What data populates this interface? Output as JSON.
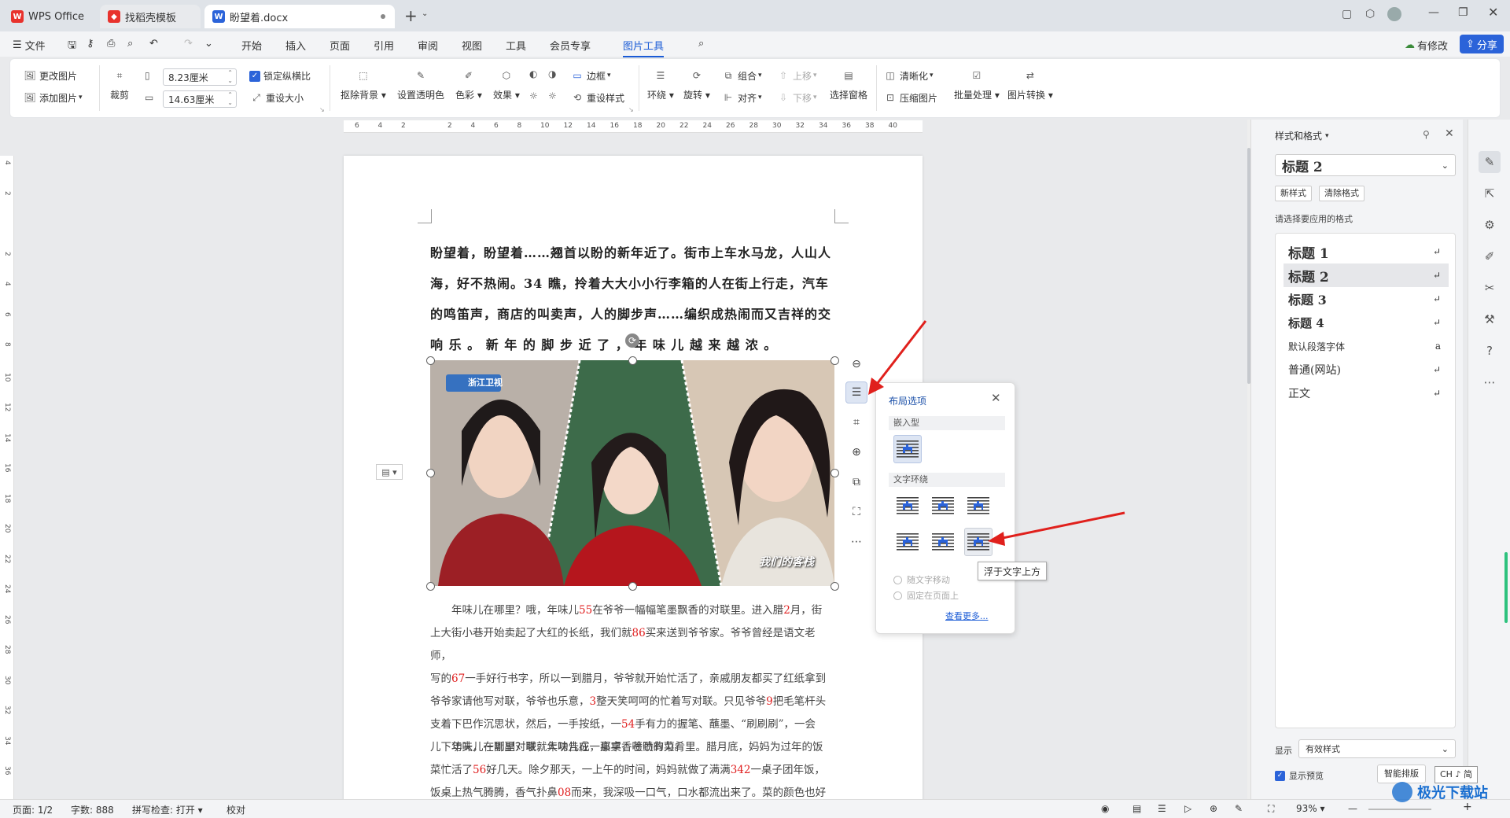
{
  "tabs": [
    {
      "label": "WPS Office",
      "icon": "wps-logo-icon"
    },
    {
      "label": "找稻壳模板",
      "icon": "daoke-icon"
    },
    {
      "label": "盼望着.docx",
      "icon": "word-doc-icon"
    }
  ],
  "menu": {
    "file": "文件",
    "items": [
      "开始",
      "插入",
      "页面",
      "引用",
      "审阅",
      "视图",
      "工具",
      "会员专享",
      "图片工具"
    ],
    "active": "图片工具",
    "modified": "有修改",
    "share": "分享"
  },
  "ribbon": {
    "change_pic": "更改图片",
    "add_pic": "添加图片",
    "crop": "裁剪",
    "width_value": "8.23厘米",
    "height_value": "14.63厘米",
    "lock_ratio": "锁定纵横比",
    "reset_size": "重设大小",
    "remove_bg": "抠除背景",
    "set_transparent": "设置透明色",
    "color": "色彩",
    "effect": "效果",
    "border": "边框",
    "reset_style": "重设样式",
    "wrap": "环绕",
    "rotate": "旋转",
    "group": "组合",
    "align": "对齐",
    "up": "上移",
    "down": "下移",
    "select_pane": "选择窗格",
    "sharpen": "清晰化",
    "compress": "压缩图片",
    "batch": "批量处理",
    "convert": "图片转换"
  },
  "ruler": {
    "h_ticks": [
      "6",
      "4",
      "2",
      "",
      "2",
      "4",
      "6",
      "8",
      "10",
      "12",
      "14",
      "16",
      "18",
      "20",
      "22",
      "24",
      "26",
      "28",
      "30",
      "32",
      "34",
      "36",
      "38",
      "40"
    ],
    "v_ticks": [
      "4",
      "2",
      "",
      "2",
      "4",
      "6",
      "8",
      "10",
      "12",
      "14",
      "16",
      "18",
      "20",
      "22",
      "24",
      "26",
      "28",
      "30",
      "32",
      "34",
      "36"
    ]
  },
  "document": {
    "bold_para": [
      "盼望着，盼望着……翘首以盼的新年近了。街市上车水马龙，人山人",
      "海，好不热闹。34 瞧，拎着大大小小行李箱的人在街上行走，汽车",
      "的鸣笛声，商店的叫卖声，人的脚步声……编织成热闹而又吉祥的交",
      "响 乐 。 新 年 的 脚 步 近 了 ， 年 味 儿 越 来 越 浓 。"
    ],
    "para1": [
      [
        "年味儿在哪里？哦，年味儿",
        "55",
        "在爷爷一幅幅笔墨飘香的对联里。进入腊",
        "2",
        "月，街"
      ],
      [
        "上大街小巷开始卖起了大红的长纸，我们就",
        "86",
        "买来送到爷爷家。爷爷曾经是语文老师，",
        "",
        ""
      ],
      [
        "写的",
        "67",
        "一手好行书字，所以一到腊月，爷爷就开始忙活了，亲戚朋友都买了红纸拿到",
        "",
        ""
      ],
      [
        "爷爷家请他写对联，爷爷也乐意，",
        "3",
        "整天笑呵呵的忙着写对联。只见爷爷",
        "9",
        "把毛笔杆头"
      ],
      [
        "支着下巴作沉思状，然后，一手按纸，一",
        "54",
        "手有力的握笔、蘸墨、“刷刷刷”，一会",
        "",
        ""
      ],
      [
        "儿下功夫，一副副对联就大功告成，那字，苍劲有力。",
        "",
        "",
        "",
        ""
      ]
    ],
    "para2": [
      [
        "年味儿在哪里？哦，年味儿在一桌桌香喷喷的菜肴里。腊月底，妈妈为过年的饭",
        "",
        "",
        "",
        ""
      ],
      [
        "菜忙活了",
        "56",
        "好几天。除夕那天，一上午的时间，妈妈就做了满满",
        "342",
        "一桌子团年饭，"
      ],
      [
        "饭桌上热气腾腾，香气扑鼻",
        "08",
        "而来，我深吸一口气，口水都流出来了。菜的颜色也好",
        "",
        ""
      ]
    ],
    "photo_logo": "浙江卫视",
    "photo_watermark": "我们的客栈"
  },
  "layout_panel": {
    "title": "布局选项",
    "inline": "嵌入型",
    "text_wrap": "文字环绕",
    "move_with_text": "随文字移动",
    "fix_on_page": "固定在页面上",
    "see_more": "查看更多..."
  },
  "tooltip": "浮于文字上方",
  "right_panel": {
    "title": "样式和格式",
    "current_style": "标题 2",
    "new_style": "新样式",
    "clear_format": "清除格式",
    "prompt": "请选择要应用的格式",
    "styles": [
      "标题 1",
      "标题 2",
      "标题 3",
      "标题 4",
      "默认段落字体",
      "普通(网站)",
      "正文"
    ],
    "show_label": "显示",
    "show_value": "有效样式",
    "preview": "显示预览",
    "smart": "智能排版"
  },
  "status": {
    "page": "页面: 1/2",
    "words": "字数: 888",
    "spell": "拼写检查: 打开",
    "proof": "校对",
    "zoom": "93%",
    "ime": "CH ♪ 简"
  },
  "watermark": "极光下载站"
}
